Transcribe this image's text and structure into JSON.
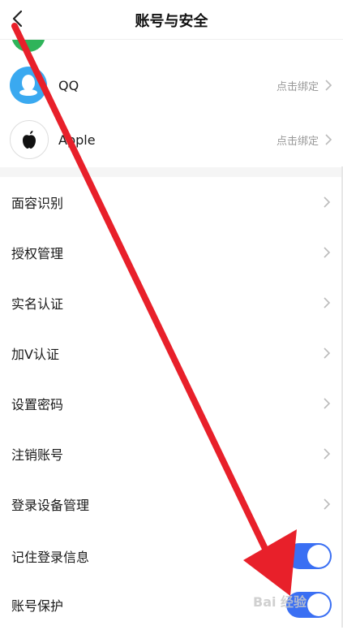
{
  "header": {
    "title": "账号与安全",
    "back_icon": "chevron-left-icon"
  },
  "bindings": [
    {
      "label": "QQ",
      "status": "点击绑定",
      "icon": "qq-icon",
      "icon_color": "#3aa9f0"
    },
    {
      "label": "Apple",
      "status": "点击绑定",
      "icon": "apple-icon",
      "icon_color": "#111111"
    }
  ],
  "menu": [
    {
      "label": "面容识别"
    },
    {
      "label": "授权管理"
    },
    {
      "label": "实名认证"
    },
    {
      "label": "加V认证"
    },
    {
      "label": "设置密码"
    },
    {
      "label": "注销账号"
    },
    {
      "label": "登录设备管理"
    }
  ],
  "toggles": [
    {
      "label": "记住登录信息",
      "on": true
    },
    {
      "label": "账号保护",
      "on": true
    }
  ],
  "colors": {
    "toggle_on": "#3a6ff3",
    "annotation_arrow": "#e8202a",
    "wechat_green": "#2fb45a"
  },
  "watermark": "Bai 经验"
}
